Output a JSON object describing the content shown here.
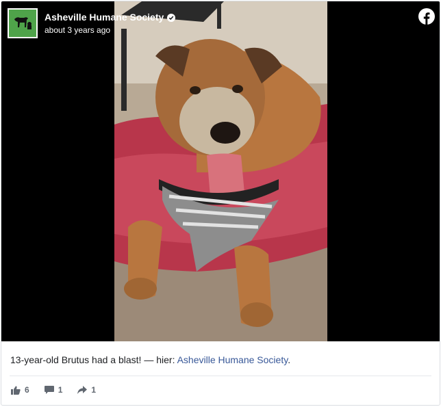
{
  "post": {
    "page_name": "Asheville Humane Society",
    "timestamp": "about 3 years ago",
    "caption_text": "13-year-old Brutus had a blast! — hier: ",
    "caption_link": "Asheville Humane Society",
    "caption_end": "."
  },
  "stats": {
    "likes": "6",
    "comments": "1",
    "shares": "1"
  },
  "icons": {
    "avatar": "dog-and-cat-logo-icon",
    "verified": "verified-badge-icon",
    "platform": "facebook-icon",
    "like": "thumbs-up-icon",
    "comment": "comment-icon",
    "share": "share-arrow-icon"
  },
  "colors": {
    "avatar_bg": "#4fa34a",
    "link": "#385898",
    "media_bg": "#000000"
  }
}
